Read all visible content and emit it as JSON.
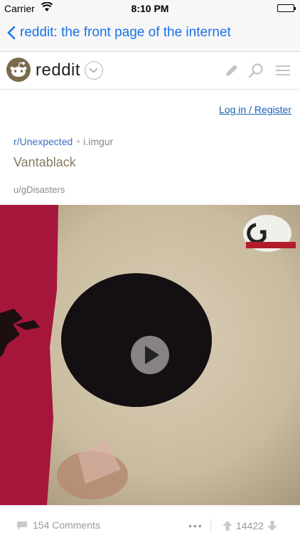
{
  "status_bar": {
    "carrier": "Carrier",
    "time": "8:10 PM"
  },
  "navbar": {
    "back_label": "reddit: the front page of the internet"
  },
  "reddit_bar": {
    "brand": "reddit",
    "icons": [
      "pencil-icon",
      "search-icon",
      "menu-icon"
    ]
  },
  "auth": {
    "login_label": "Log in / Register"
  },
  "post": {
    "subreddit": "r/Unexpected",
    "domain": "i.imgur",
    "title": "Vantablack",
    "author": "u/gDisasters",
    "comments": "154 Comments",
    "more": "•••",
    "score": "14422"
  },
  "colors": {
    "link": "#1a73e8",
    "title": "#8a7a60",
    "meta": "#888888",
    "brand_logo": "#7b6a4d"
  }
}
